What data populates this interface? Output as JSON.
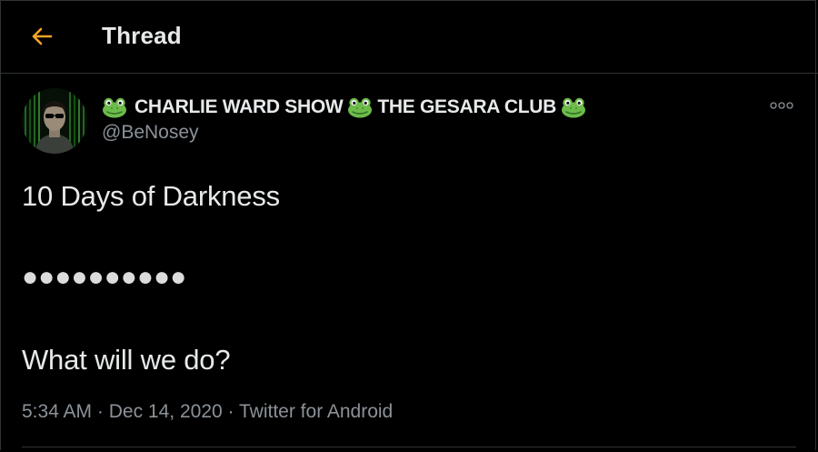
{
  "header": {
    "title": "Thread",
    "back_icon": "arrow-left-icon",
    "accent_color": "#f7a428"
  },
  "tweet": {
    "author": {
      "display_name_part1": "CHARLIE WARD SHOW",
      "display_name_part2": "THE GESARA CLUB",
      "emoji": "frog-face-icon",
      "handle": "@BeNosey"
    },
    "lines": [
      "10 Days of Darkness",
      "●●●●●●●●●●",
      "What will we do?"
    ],
    "meta": {
      "time": "5:34 AM",
      "separator": "·",
      "date": "Dec 14, 2020",
      "client": "Twitter for Android"
    },
    "more_icon": "more-options-icon"
  },
  "colors": {
    "background": "#000000",
    "text_primary": "#e7e9ea",
    "text_secondary": "#8b9298",
    "border": "#2f3336"
  }
}
